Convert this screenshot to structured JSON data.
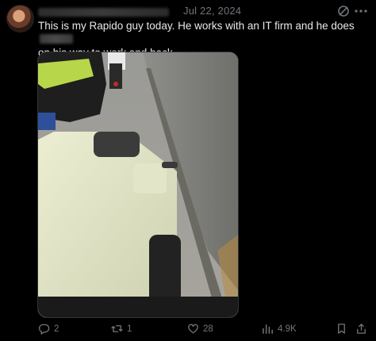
{
  "post": {
    "date": "Jul 22, 2024",
    "text_line1": "This is my Rapido guy today. He works with an IT firm and he does",
    "text_line2": "on his way to work and back."
  },
  "actions": {
    "replies": "2",
    "reposts": "1",
    "likes": "28",
    "views": "4.9K"
  },
  "icons": [
    "grok-icon",
    "more-icon",
    "reply-icon",
    "repost-icon",
    "like-icon",
    "views-icon",
    "bookmark-icon",
    "share-icon"
  ],
  "colors": {
    "background": "#000000",
    "text": "#e7e9ea",
    "muted": "#71767b"
  }
}
